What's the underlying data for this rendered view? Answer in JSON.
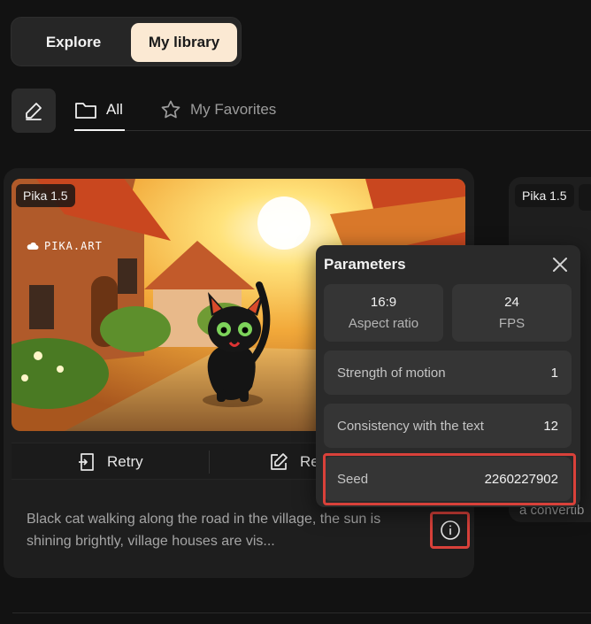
{
  "top_toggle": {
    "explore": "Explore",
    "library": "My library"
  },
  "tabs": {
    "all": "All",
    "favorites": "My Favorites"
  },
  "card": {
    "model_badge": "Pika 1.5",
    "watermark": "PIKA.ART",
    "actions": {
      "retry": "Retry",
      "edit": "Re"
    },
    "prompt": "Black cat walking along the road in the village, the sun is shining brightly, village houses are vis..."
  },
  "card2": {
    "model_badge": "Pika 1.5",
    "prompt_fragment": "a convertib"
  },
  "parameters": {
    "title": "Parameters",
    "aspect_ratio": {
      "value": "16:9",
      "label": "Aspect ratio"
    },
    "fps": {
      "value": "24",
      "label": "FPS"
    },
    "strength_of_motion": {
      "label": "Strength of motion",
      "value": "1"
    },
    "consistency": {
      "label": "Consistency with the text",
      "value": "12"
    },
    "seed": {
      "label": "Seed",
      "value": "2260227902"
    }
  },
  "colors": {
    "accent": "#fbe9d3",
    "highlight": "#d9413a",
    "background": "#121212",
    "panel": "#2a2a2a"
  },
  "icons": [
    "pencil-icon",
    "folder-icon",
    "star-icon",
    "retry-icon",
    "edit-icon",
    "info-icon",
    "close-icon",
    "cloud-icon"
  ]
}
